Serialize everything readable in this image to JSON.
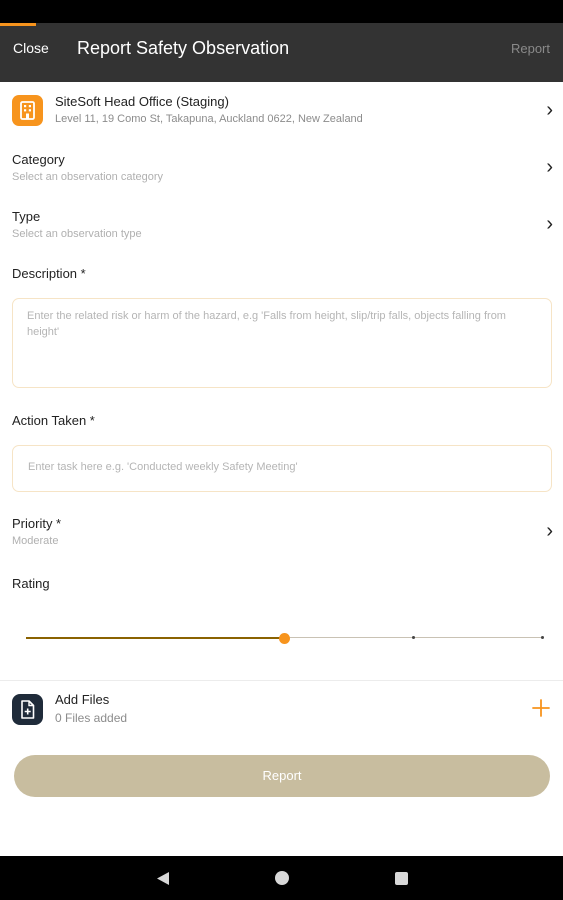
{
  "app_bar": {
    "close_label": "Close",
    "title": "Report Safety Observation",
    "report_label": "Report"
  },
  "site": {
    "name": "SiteSoft Head Office (Staging)",
    "address": "Level 11, 19 Como St, Takapuna, Auckland 0622, New Zealand",
    "icon": "building-icon"
  },
  "category": {
    "label": "Category",
    "placeholder": "Select an observation category"
  },
  "type": {
    "label": "Type",
    "placeholder": "Select an observation type"
  },
  "description": {
    "label": "Description *",
    "placeholder": "Enter the related risk or harm of the hazard, e.g 'Falls from height, slip/trip falls, objects falling from height'",
    "value": ""
  },
  "action_taken": {
    "label": "Action Taken *",
    "placeholder": "Enter task here e.g. 'Conducted weekly Safety Meeting'",
    "value": ""
  },
  "priority": {
    "label": "Priority *",
    "value": "Moderate"
  },
  "rating": {
    "label": "Rating",
    "value_fraction": 0.5,
    "steps": 5
  },
  "files": {
    "label": "Add Files",
    "count_text": "0 Files added",
    "icon": "file-icon",
    "add_icon": "plus-icon"
  },
  "submit": {
    "label": "Report"
  },
  "colors": {
    "accent": "#f7941d",
    "app_bar": "#333333",
    "button_disabled": "#c8bd9f",
    "slider_fill": "#8a6200",
    "files_icon_bg": "#1f2b3a"
  }
}
